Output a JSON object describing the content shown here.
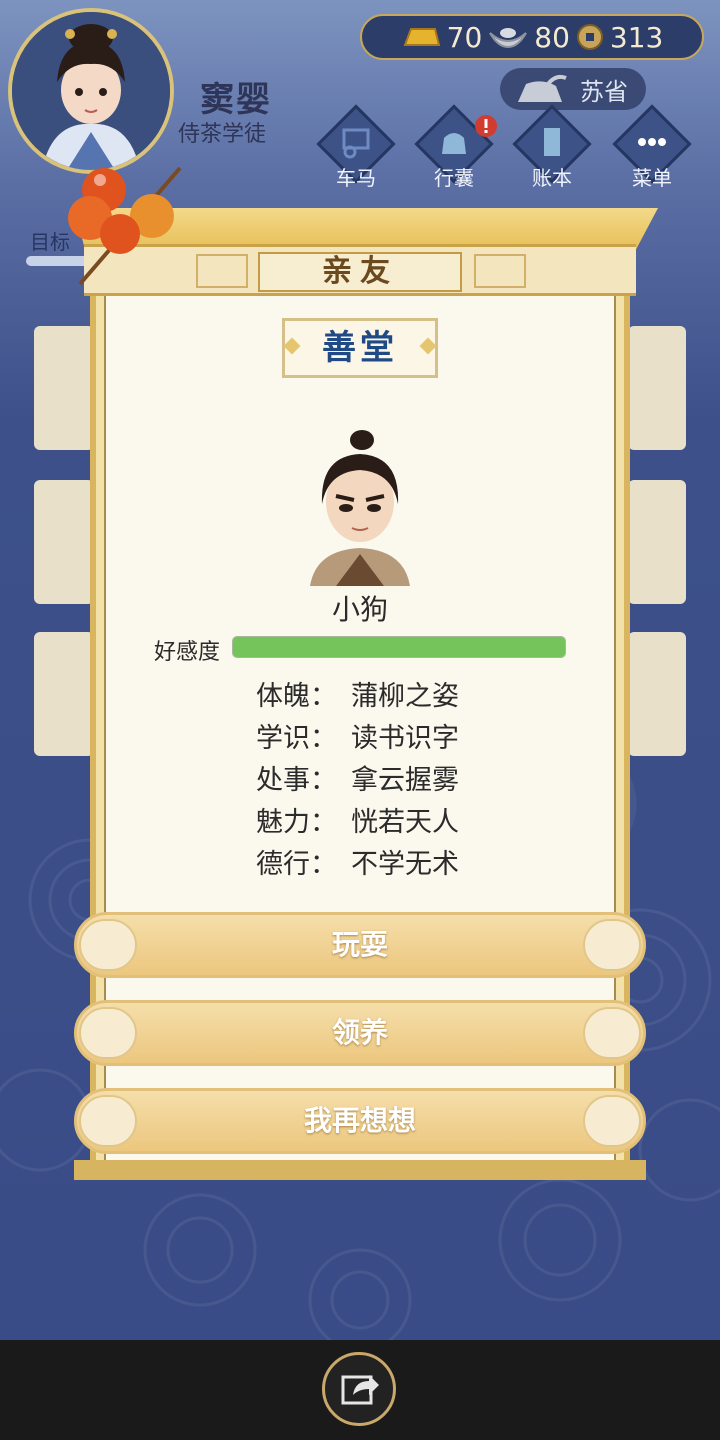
{
  "header": {
    "player_name": "窦婴",
    "player_title": "侍茶学徒",
    "currency": {
      "gold": "70",
      "silver": "80",
      "coins": "313"
    },
    "region": "苏省",
    "nav": [
      {
        "label": "车马",
        "icon": "carriage-icon"
      },
      {
        "label": "行囊",
        "icon": "bag-icon"
      },
      {
        "label": "账本",
        "icon": "ledger-icon"
      },
      {
        "label": "菜单",
        "icon": "menu-icon"
      }
    ],
    "goal_label": "目标"
  },
  "dialog": {
    "title": "亲友",
    "section": "善堂",
    "character_name": "小狗",
    "affinity_label": "好感度",
    "affinity_fraction": 1.0,
    "stats": [
      {
        "label": "体魄：",
        "value": "蒲柳之姿"
      },
      {
        "label": "学识：",
        "value": "读书识字"
      },
      {
        "label": "处事：",
        "value": "拿云握雾"
      },
      {
        "label": "魅力：",
        "value": "恍若天人"
      },
      {
        "label": "德行：",
        "value": "不学无术"
      }
    ],
    "buttons": {
      "play": "玩耍",
      "adopt": "领养",
      "reconsider": "我再想想"
    }
  },
  "colors": {
    "affinity_green": "#74c35b",
    "accent_gold": "#e6be55",
    "section_blue": "#1f4a86"
  }
}
